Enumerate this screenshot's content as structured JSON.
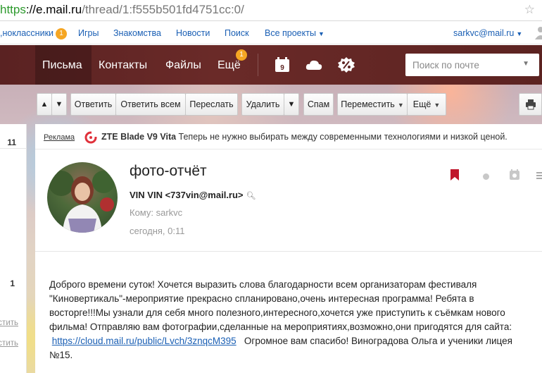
{
  "browser": {
    "url_scheme": "https",
    "url_host": "://e.mail.ru",
    "url_path": "/thread/1:f555b501fd4751cc:0/"
  },
  "portal": {
    "items": [
      {
        "label": "одноклассники",
        "visible_text": ",ноклассники",
        "badge": "1"
      },
      {
        "label": "Игры"
      },
      {
        "label": "Знакомства"
      },
      {
        "label": "Новости"
      },
      {
        "label": "Поиск"
      },
      {
        "label": "Все проекты"
      }
    ],
    "user_email": "sarkvc@mail.ru"
  },
  "header": {
    "tabs": [
      {
        "label": "Письма",
        "active": true
      },
      {
        "label": "Контакты"
      },
      {
        "label": "Файлы"
      },
      {
        "label": "Ещё",
        "badge": "1"
      }
    ],
    "calendar_day": "9",
    "search_placeholder": "Поиск по почте"
  },
  "toolbar": {
    "reply": "Ответить",
    "reply_all": "Ответить всем",
    "forward": "Переслать",
    "delete": "Удалить",
    "spam": "Спам",
    "move": "Переместить",
    "more": "Ещё"
  },
  "sidebar": {
    "count_top": "11",
    "count_bottom": "1",
    "link_1": "стить",
    "link_2": "стить"
  },
  "ad": {
    "label": "Реклама",
    "brand": "ZTE Blade V9 Vita",
    "text": "Теперь не нужно выбирать между современными технологиями и низкой ценой."
  },
  "message": {
    "subject": "фото-отчёт",
    "from": "VIN VIN <737vin@mail.ru>",
    "to": "Кому: sarkvc",
    "date": "сегодня, 0:11",
    "body_lines": [
      "Доброго времени суток! Хочется выразить слова благодарности всем организаторам фестиваля",
      "\"Киновертикаль\"-мероприятие прекрасно спланировано,очень интересная программа! Ребята в",
      "восторге!!!Мы узнали для себя много полезного,интересного,хочется уже приступить к съёмкам нового",
      "фильма! Отправляю вам фотографии,сделанные на мероприятиях,возможно,они пригодятся для сайта:"
    ],
    "link": "https://cloud.mail.ru/public/Lvch/3znqcM395",
    "after_link": "Огромное вам спасибо!  Виноградова Ольга и ученики лицея",
    "last_line": "№15."
  },
  "colors": {
    "header_bg": "#5f2624",
    "link": "#1a5fb4",
    "badge": "#f5a623",
    "flag": "#c0162b"
  }
}
